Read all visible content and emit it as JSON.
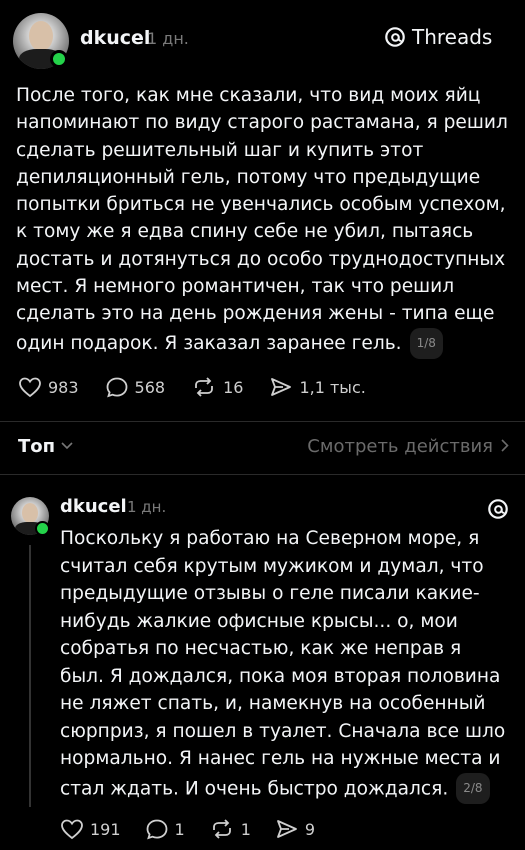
{
  "post": {
    "username": "dkucel",
    "time": "1 дн.",
    "brand": "Threads",
    "text": "После того, как мне сказали, что вид моих яйц напоминают по виду старого растамана, я решил сделать решительный шаг и купить этот депиляционный гель, потому что предыдущие попытки бриться не увенчались особым успехом, к тому же я едва спину себе не убил, пытаясь достать и дотянуться до особо труднодоступных мест. Я немного романтичен, так что решил сделать это на день рождения жены - типа еще один подарок. Я заказал заранее гель.",
    "badge": "1/8",
    "likes": "983",
    "comments": "568",
    "reposts": "16",
    "shares": "1,1 тыс."
  },
  "sort_bar": {
    "sort_label": "Топ",
    "view_activity": "Смотреть действия"
  },
  "reply": {
    "username": "dkucel",
    "time": "1 дн.",
    "text": "Поскольку я работаю на Северном море, я считал себя крутым мужиком и думал, что предыдущие отзывы о геле писали какие-нибудь жалкие офисные крысы... о, мои собратья по несчастью, как же неправ я был. Я дождался, пока моя вторая половина не ляжет спать, и, намекнув на особенный сюрприз, я пошел в туалет. Сначала все шло нормально. Я нанес гель на нужные места и стал ждать. И очень быстро дождался.",
    "badge": "2/8",
    "likes": "191",
    "comments": "1",
    "reposts": "1",
    "shares": "9"
  },
  "colors": {
    "background": "#000000",
    "online": "#24d34a",
    "text": "#f3f5f7",
    "muted": "#7a7a7a"
  }
}
